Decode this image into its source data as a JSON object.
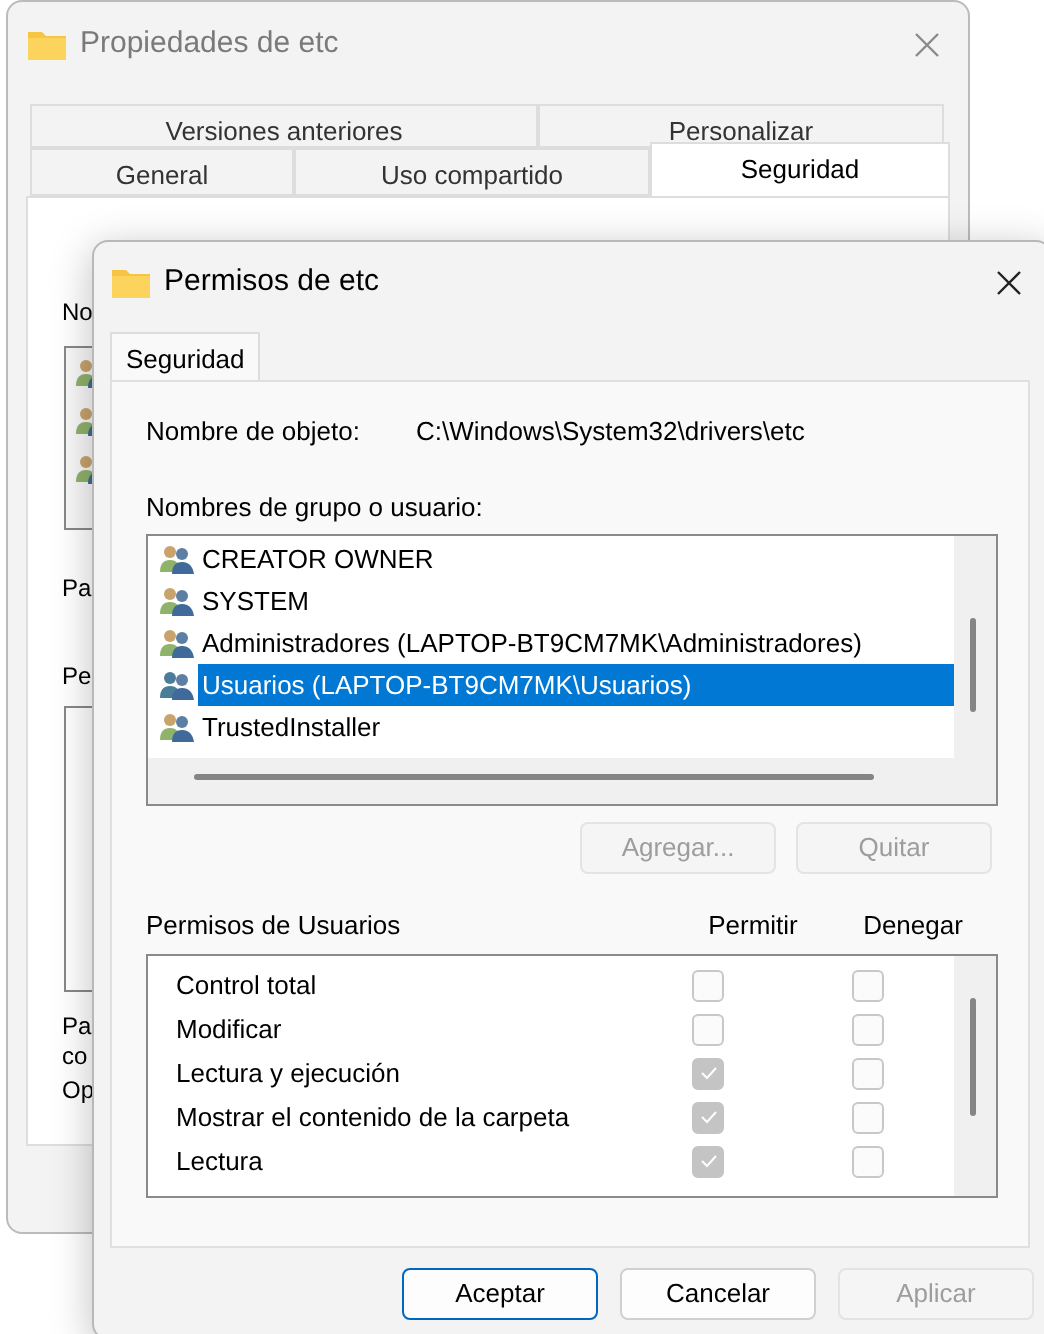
{
  "back_window": {
    "title": "Propiedades de etc",
    "tabs_row_1": [
      {
        "label": "Versiones anteriores",
        "selected": false
      },
      {
        "label": "Personalizar",
        "selected": false
      }
    ],
    "tabs_row_2": [
      {
        "label": "General",
        "selected": false
      },
      {
        "label": "Uso compartido",
        "selected": false
      },
      {
        "label": "Seguridad",
        "selected": true
      }
    ],
    "visible_fragments": [
      "No",
      "Pa",
      "Pe",
      "Pa",
      "co",
      "Op"
    ]
  },
  "dialog": {
    "title": "Permisos de etc",
    "tab": {
      "label": "Seguridad",
      "selected": true
    },
    "object_label": "Nombre de objeto:",
    "object_path": "C:\\Windows\\System32\\drivers\\etc",
    "users_label": "Nombres de grupo o usuario:",
    "users": [
      {
        "name": "CREATOR OWNER",
        "selected": false
      },
      {
        "name": "SYSTEM",
        "selected": false
      },
      {
        "name": "Administradores (LAPTOP-BT9CM7MK\\Administradores)",
        "selected": false
      },
      {
        "name": "Usuarios (LAPTOP-BT9CM7MK\\Usuarios)",
        "selected": true
      },
      {
        "name": "TrustedInstaller",
        "selected": false
      }
    ],
    "user_buttons": [
      {
        "label": "Agregar...",
        "disabled": true
      },
      {
        "label": "Quitar",
        "disabled": true
      }
    ],
    "permissions_label": "Permisos de Usuarios",
    "allow_header": "Permitir",
    "deny_header": "Denegar",
    "permissions": [
      {
        "name": "Control total",
        "allow": false,
        "deny": false
      },
      {
        "name": "Modificar",
        "allow": false,
        "deny": false
      },
      {
        "name": "Lectura y ejecución",
        "allow": true,
        "deny": false
      },
      {
        "name": "Mostrar el contenido de la carpeta",
        "allow": true,
        "deny": false
      },
      {
        "name": "Lectura",
        "allow": true,
        "deny": false
      }
    ],
    "buttons": [
      {
        "label": "Aceptar",
        "kind": "default",
        "disabled": false
      },
      {
        "label": "Cancelar",
        "kind": "normal",
        "disabled": false
      },
      {
        "label": "Aplicar",
        "kind": "normal",
        "disabled": true
      }
    ]
  }
}
